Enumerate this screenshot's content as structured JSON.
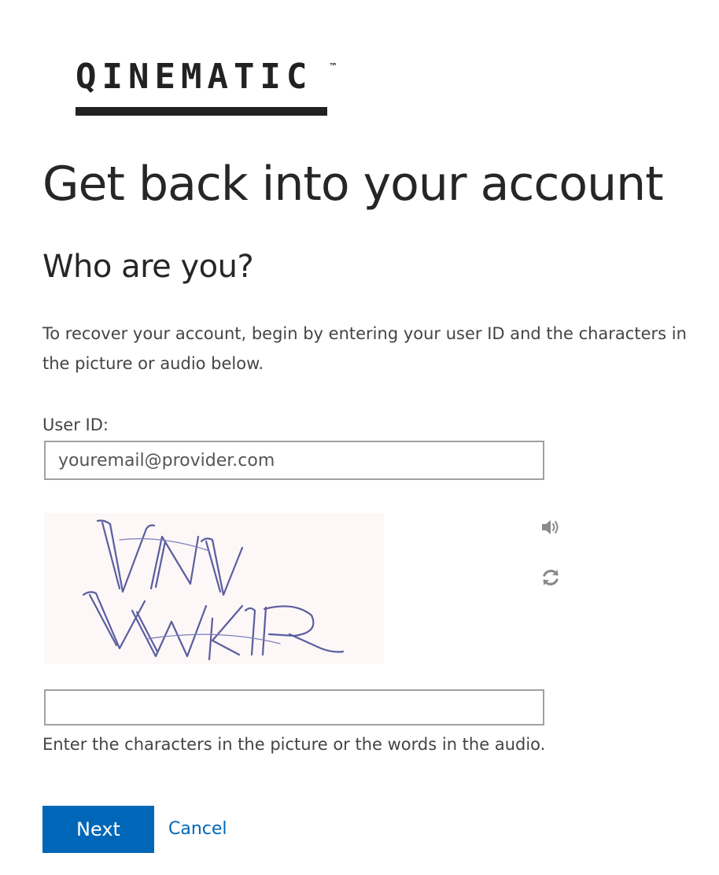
{
  "brand": {
    "logo_text": "QINEMATIC",
    "trademark": "™"
  },
  "page": {
    "title": "Get back into your account",
    "subtitle": "Who are you?",
    "instructions": "To recover your account, begin by entering your user ID and the characters in the picture or audio below."
  },
  "user_id": {
    "label": "User ID:",
    "placeholder": "youremail@provider.com",
    "value": ""
  },
  "captcha": {
    "image_text": "VNV VWKIR",
    "audio_icon": "speaker-icon",
    "refresh_icon": "refresh-icon",
    "input_value": "",
    "hint": "Enter the characters in the picture or the words in the audio."
  },
  "actions": {
    "next_label": "Next",
    "cancel_label": "Cancel"
  },
  "colors": {
    "accent": "#0067b8",
    "captcha_ink": "#5a5e9e",
    "captcha_bg": "#fdf7f8"
  }
}
